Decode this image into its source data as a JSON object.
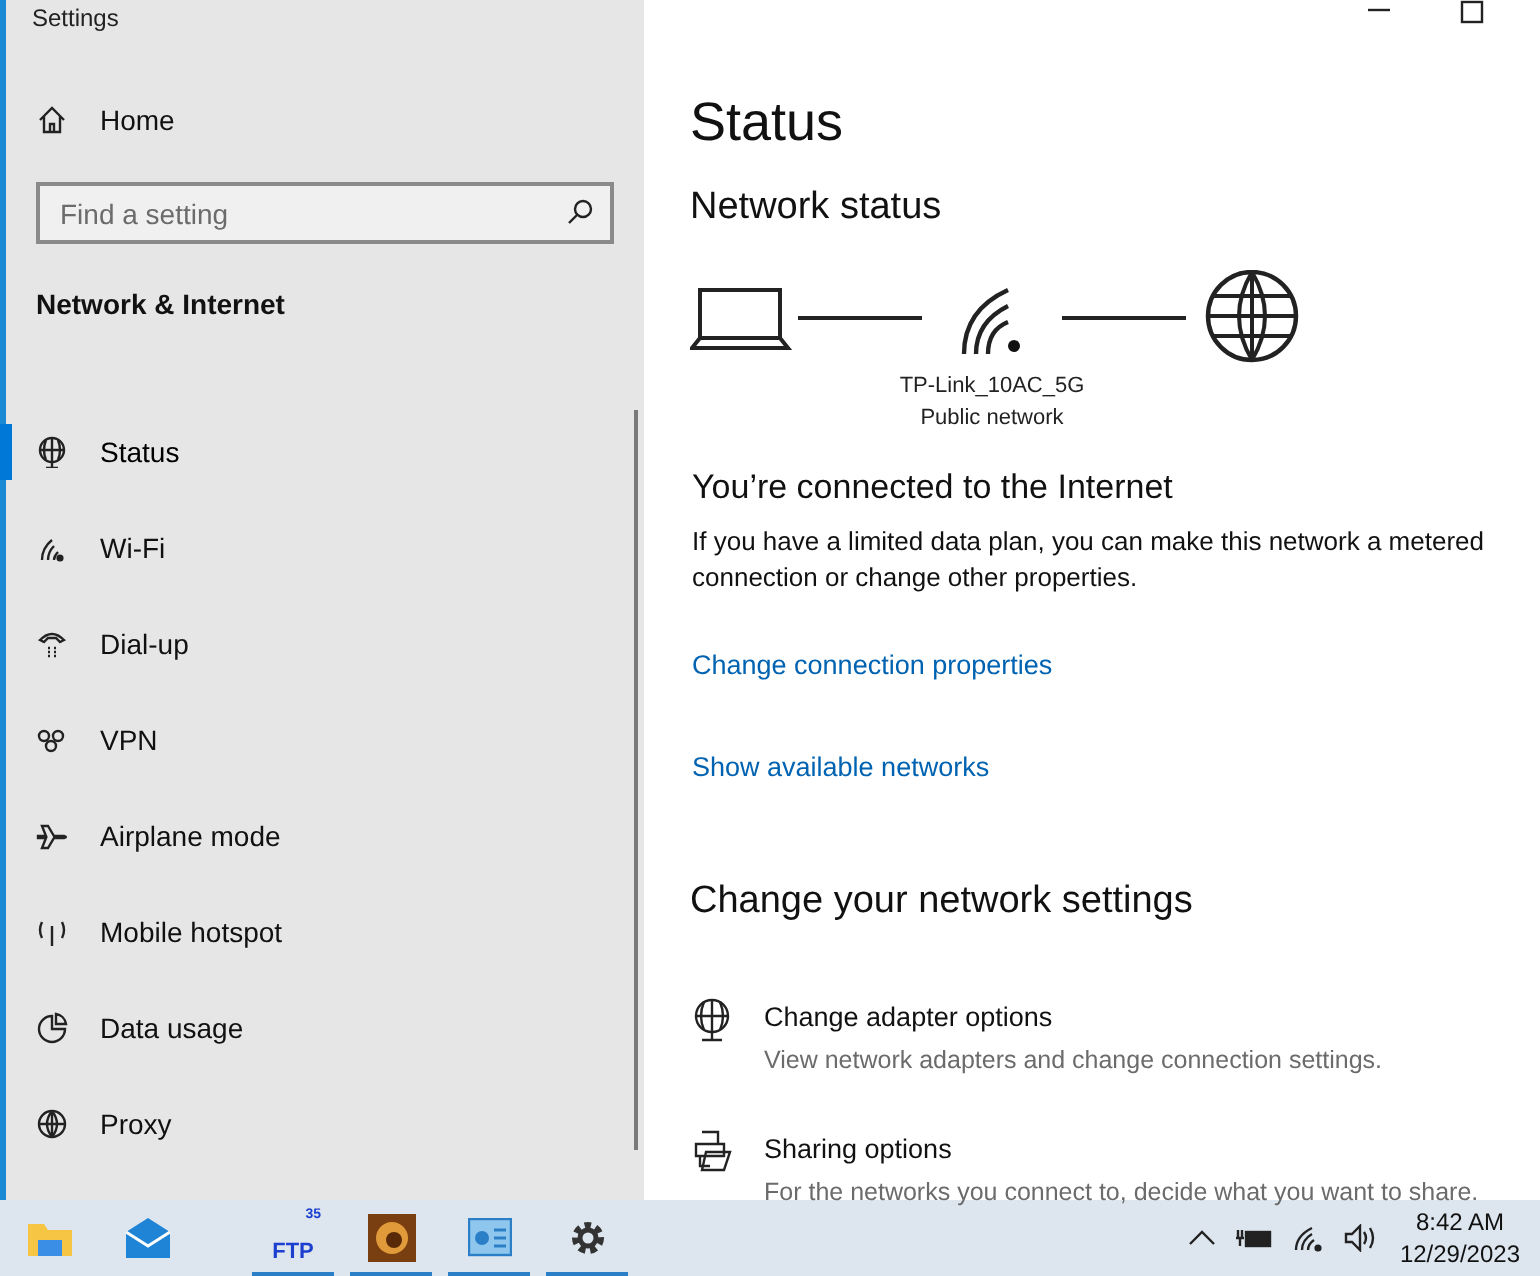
{
  "window": {
    "title": "Settings"
  },
  "sidebar": {
    "home": "Home",
    "search": {
      "placeholder": "Find a setting"
    },
    "section": "Network & Internet",
    "items": [
      {
        "label": "Status",
        "selected": true
      },
      {
        "label": "Wi-Fi",
        "selected": false
      },
      {
        "label": "Dial-up",
        "selected": false
      },
      {
        "label": "VPN",
        "selected": false
      },
      {
        "label": "Airplane mode",
        "selected": false
      },
      {
        "label": "Mobile hotspot",
        "selected": false
      },
      {
        "label": "Data usage",
        "selected": false
      },
      {
        "label": "Proxy",
        "selected": false
      }
    ]
  },
  "main": {
    "title": "Status",
    "network_status": "Network status",
    "network": {
      "name": "TP-Link_10AC_5G",
      "profile": "Public network"
    },
    "connected_heading": "You’re connected to the Internet",
    "connected_text": "If you have a limited data plan, you can make this network a metered connection or change other properties.",
    "links": [
      "Change connection properties",
      "Show available networks"
    ],
    "settings_heading": "Change your network settings",
    "options": [
      {
        "title": "Change adapter options",
        "description": "View network adapters and change connection settings."
      },
      {
        "title": "Sharing options",
        "description": "For the networks you connect to, decide what you want to share."
      }
    ]
  },
  "taskbar": {
    "apps": [
      {
        "kind": "folder",
        "running": false
      },
      {
        "kind": "mail",
        "running": false
      },
      {
        "kind": "ftp",
        "label": "FTP",
        "badge": "35",
        "running": true
      },
      {
        "kind": "photo",
        "running": true
      },
      {
        "kind": "panel",
        "running": true
      },
      {
        "kind": "settings",
        "running": true
      }
    ],
    "time": "8:42 AM",
    "date": "12/29/2023"
  }
}
